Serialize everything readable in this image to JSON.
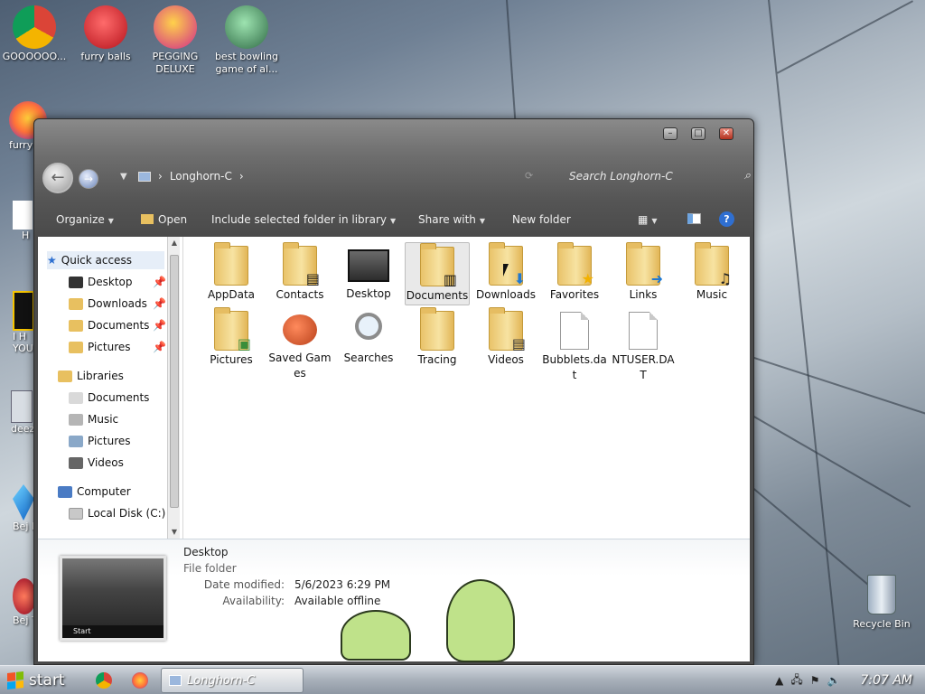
{
  "desktop": {
    "icons": [
      {
        "label": "GOOOOOO..."
      },
      {
        "label": "furry balls"
      },
      {
        "label": "PEGGING DELUXE"
      },
      {
        "label": "best bowling game of al..."
      }
    ],
    "partial_labels": [
      "furry",
      "H",
      "I H YOU",
      "deez",
      "Bej Del",
      "Bej Tw"
    ],
    "recycle_bin": "Recycle Bin"
  },
  "window": {
    "breadcrumb": "Longhorn-C",
    "search_placeholder": "Search Longhorn-C",
    "toolbar": {
      "organize": "Organize",
      "open": "Open",
      "include": "Include selected folder in library",
      "share": "Share with",
      "new_folder": "New folder"
    },
    "nav": {
      "quick_access": "Quick access",
      "quick_items": [
        "Desktop",
        "Downloads",
        "Documents",
        "Pictures"
      ],
      "libraries": "Libraries",
      "library_items": [
        "Documents",
        "Music",
        "Pictures",
        "Videos"
      ],
      "computer": "Computer",
      "local_disk": "Local Disk (C:)"
    },
    "files": [
      {
        "name": "AppData"
      },
      {
        "name": "Contacts"
      },
      {
        "name": "Desktop"
      },
      {
        "name": "Documents"
      },
      {
        "name": "Downloads"
      },
      {
        "name": "Favorites"
      },
      {
        "name": "Links"
      },
      {
        "name": "Music"
      },
      {
        "name": "Pictures"
      },
      {
        "name": "Saved Games"
      },
      {
        "name": "Searches"
      },
      {
        "name": "Tracing"
      },
      {
        "name": "Videos"
      },
      {
        "name": "Bubblets.dat"
      },
      {
        "name": "NTUSER.DAT"
      }
    ],
    "details": {
      "name": "Desktop",
      "type": "File folder",
      "date_label": "Date modified:",
      "date_value": "5/6/2023 6:29 PM",
      "avail_label": "Availability:",
      "avail_value": "Available offline",
      "preview_start": "Start"
    }
  },
  "taskbar": {
    "start": "start",
    "active_window": "Longhorn-C",
    "clock": "7:07 AM"
  }
}
